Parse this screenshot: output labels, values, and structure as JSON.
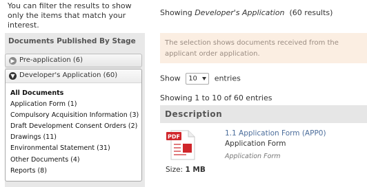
{
  "intro_text": "You can filter the results to show only the items that match your interest.",
  "sidebar": {
    "title": "Documents Published By Stage",
    "stages": [
      {
        "label": "Pre-application (6)",
        "expanded": false
      },
      {
        "label": "Developer's Application (60)",
        "expanded": true
      }
    ],
    "documents": [
      "All Documents",
      "Application Form (1)",
      "Compulsory Acquisition Information (3)",
      "Draft Development Consent Orders (2)",
      "Drawings (11)",
      "Environmental Statement (31)",
      "Other Documents (4)",
      "Reports (8)"
    ]
  },
  "results": {
    "showing_prefix": "Showing",
    "stage_name": "Developer's Application",
    "count_text": "(60 results)",
    "notice": "The selection shows documents received from the applicant order application.",
    "show_label": "Show",
    "entries_value": "10",
    "entries_label": "entries",
    "showing_count": "Showing 1 to 10 of 60 entries",
    "table_header": "Description"
  },
  "document": {
    "icon_label": "PDF",
    "title": "1.1 Application Form (APP0)",
    "type": "Application Form",
    "category": "Application Form",
    "size_label": "Size:",
    "size_value": "1 MB"
  },
  "colors": {
    "link": "#4b6d9b",
    "notice_bg": "#fbeee2",
    "pdf_red": "#d0262b"
  }
}
